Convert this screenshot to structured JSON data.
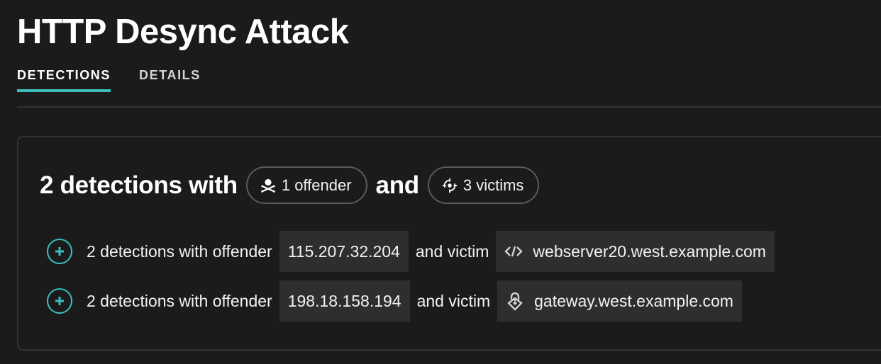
{
  "page": {
    "title": "HTTP Desync Attack"
  },
  "tabs": [
    {
      "label": "DETECTIONS",
      "active": true
    },
    {
      "label": "DETAILS",
      "active": false
    }
  ],
  "summary": {
    "prefix": "2 detections with",
    "offender_pill": {
      "icon": "skull-crossbones-icon",
      "label": "1 offender"
    },
    "conjunction": "and",
    "victim_pill": {
      "icon": "crosshair-target-icon",
      "label": "3 victims"
    }
  },
  "rows": [
    {
      "expand_icon": "plus-circle-icon",
      "prefix": "2 detections with offender",
      "offender": "115.207.32.204",
      "middle": "and victim",
      "victim_icon": "code-brackets-icon",
      "victim": "webserver20.west.example.com"
    },
    {
      "expand_icon": "plus-circle-icon",
      "prefix": "2 detections with offender",
      "offender": "198.18.158.194",
      "middle": "and victim",
      "victim_icon": "gateway-lock-icon",
      "victim": "gateway.west.example.com"
    }
  ],
  "colors": {
    "background": "#1b1b1b",
    "accent": "#3cbfbb",
    "chip": "#2e2e2e",
    "border": "#333333"
  }
}
